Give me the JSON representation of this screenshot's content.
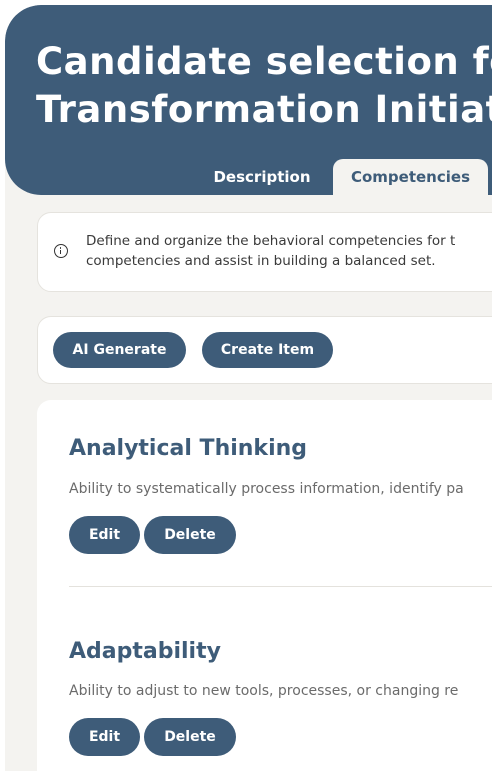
{
  "header": {
    "title_line1": "Candidate selection for",
    "title_line2": "Transformation Initiative"
  },
  "tabs": [
    {
      "label": "Description",
      "active": false
    },
    {
      "label": "Competencies",
      "active": true
    }
  ],
  "info": {
    "icon": "info-icon",
    "line1": "Define and organize the behavioral competencies for t",
    "line2": "competencies and assist in building a balanced set."
  },
  "actions": {
    "ai_generate_label": "AI Generate",
    "create_item_label": "Create Item"
  },
  "items": [
    {
      "title": "Analytical Thinking",
      "description": "Ability to systematically process information, identify pa",
      "edit_label": "Edit",
      "delete_label": "Delete"
    },
    {
      "title": "Adaptability",
      "description": "Ability to adjust to new tools, processes, or changing re",
      "edit_label": "Edit",
      "delete_label": "Delete"
    }
  ],
  "colors": {
    "primary": "#3e5c79",
    "page_background": "#f4f3f0",
    "card_background": "#ffffff",
    "muted_text": "#6b6b6b"
  }
}
